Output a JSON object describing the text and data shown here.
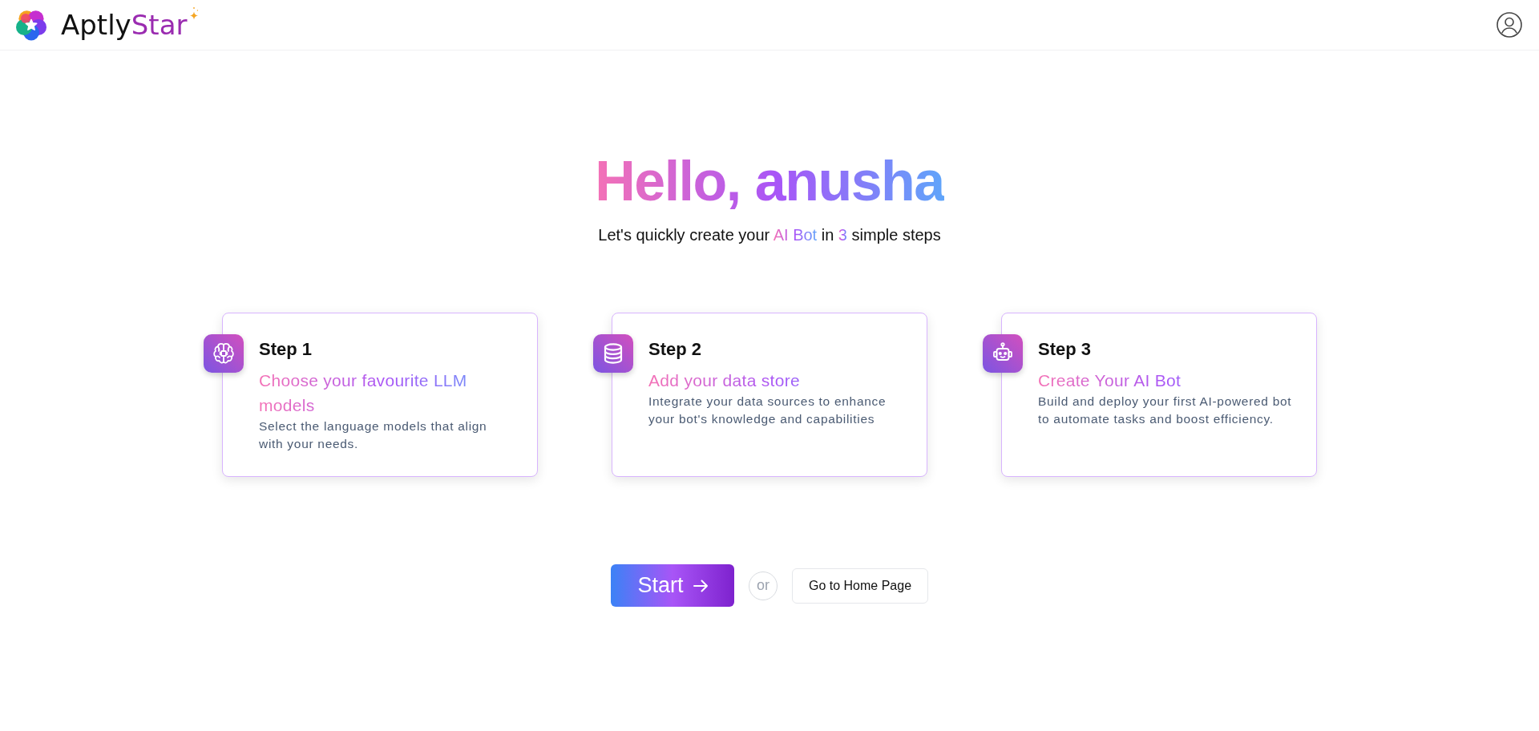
{
  "header": {
    "brand": [
      {
        "text": "Aptly",
        "accent": false
      },
      {
        "text": "Star",
        "accent": true
      }
    ]
  },
  "greeting": {
    "title": "Hello, anusha",
    "subtitle": [
      {
        "text": "Let's quickly create your ",
        "highlight": false
      },
      {
        "text": "AI Bot",
        "highlight": true
      },
      {
        "text": " in ",
        "highlight": false
      },
      {
        "text": "3",
        "highlight": true
      },
      {
        "text": " simple steps",
        "highlight": false
      }
    ]
  },
  "steps": [
    {
      "kind": "models",
      "title": "Step 1",
      "heading": "Choose your favourite LLM models",
      "description": "Select the language models that align with your needs."
    },
    {
      "kind": "data",
      "title": "Step 2",
      "heading": "Add your data store",
      "description": "Integrate your data sources to enhance your bot's knowledge and capabilities"
    },
    {
      "kind": "bot",
      "title": "Step 3",
      "heading": "Create Your AI Bot",
      "description": "Build and deploy your first AI-powered bot to automate tasks and boost efficiency."
    }
  ],
  "actions": {
    "start_button": {
      "label": "Start"
    },
    "separator": "or",
    "home_button": {
      "label": "Go to Home Page"
    }
  }
}
